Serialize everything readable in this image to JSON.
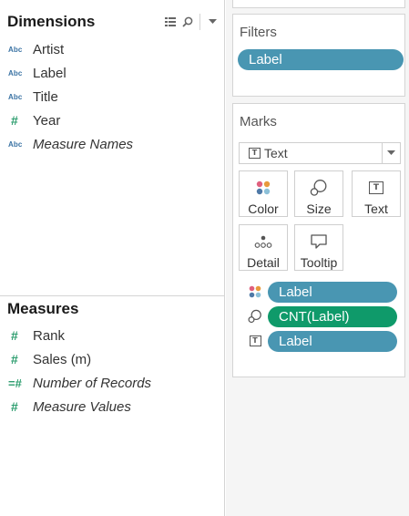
{
  "dimensions": {
    "title": "Dimensions",
    "fields": [
      {
        "type": "abc",
        "icon": "abc",
        "label": "Artist",
        "italic": false
      },
      {
        "type": "abc",
        "icon": "abc",
        "label": "Label",
        "italic": false
      },
      {
        "type": "abc",
        "icon": "abc",
        "label": "Title",
        "italic": false
      },
      {
        "type": "hash",
        "icon": "#",
        "label": "Year",
        "italic": false
      },
      {
        "type": "abc",
        "icon": "abc",
        "label": "Measure Names",
        "italic": true
      }
    ]
  },
  "measures": {
    "title": "Measures",
    "fields": [
      {
        "type": "hash",
        "icon": "#",
        "label": "Rank",
        "italic": false
      },
      {
        "type": "hash",
        "icon": "#",
        "label": "Sales (m)",
        "italic": false
      },
      {
        "type": "hash-eq",
        "icon": "=#",
        "label": "Number of Records",
        "italic": true
      },
      {
        "type": "hash",
        "icon": "#",
        "label": "Measure Values",
        "italic": true
      }
    ]
  },
  "filters": {
    "title": "Filters",
    "pills": [
      {
        "label": "Label",
        "color": "#4996b2"
      }
    ]
  },
  "marks": {
    "title": "Marks",
    "mark_type": "Text",
    "buttons": {
      "color": "Color",
      "size": "Size",
      "text": "Text",
      "detail": "Detail",
      "tooltip": "Tooltip"
    },
    "rows": [
      {
        "encoding": "color",
        "label": "Label",
        "color": "#4996b2"
      },
      {
        "encoding": "size",
        "label": "CNT(Label)",
        "color": "#0f9a6a"
      },
      {
        "encoding": "text",
        "label": "Label",
        "color": "#4996b2"
      }
    ]
  },
  "icons": {
    "abc_text": "Abc",
    "hash_text": "#",
    "hash_eq_text": "=#",
    "text_box_glyph": "T"
  },
  "colors": {
    "dimension_blue": "#3b73a4",
    "measure_green": "#2c9d6e",
    "pill_blue": "#4996b2",
    "pill_green": "#0f9a6a"
  }
}
